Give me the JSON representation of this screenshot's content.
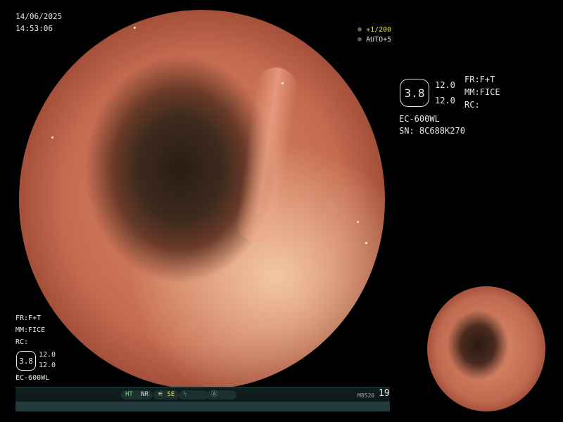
{
  "date": "14/06/2025",
  "time": "14:53:06",
  "shutter": "1/200",
  "auto": "AUTO+5",
  "right_panel": {
    "value": "3.8",
    "line1": "12.0",
    "line2": "12.0",
    "fr": "FR:F+T",
    "mm": "MM:FICE",
    "rc": "RC:",
    "model": "EC-600WL",
    "serial": "SN: 8C688K270"
  },
  "left_panel": {
    "fr": "FR:F+T",
    "mm": "MM:FICE",
    "rc": "RC:",
    "value": "3.8",
    "line1": "12.0",
    "line2": "12.0",
    "model": "EC-600WL"
  },
  "status": {
    "ht": "HT",
    "nr": "NR",
    "se": "SE",
    "code": "M8520",
    "number": "19"
  },
  "colors": {
    "accent_yellow": "#e8e04a",
    "accent_green": "#7fd07f"
  }
}
